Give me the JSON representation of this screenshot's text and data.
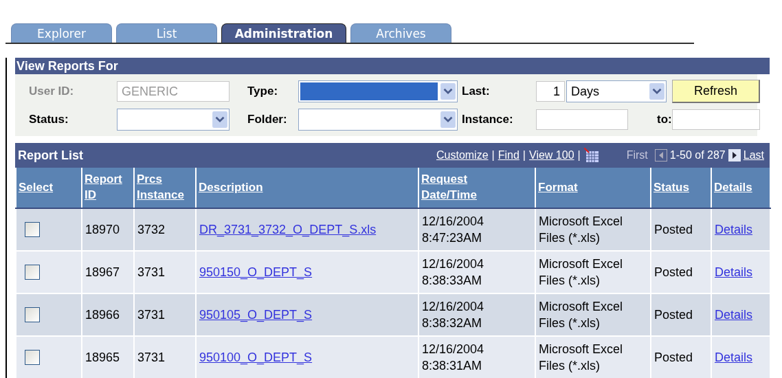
{
  "tabs": [
    {
      "label": "Explorer",
      "selected": false
    },
    {
      "label": "List",
      "selected": false
    },
    {
      "label": "Administration",
      "selected": true
    },
    {
      "label": "Archives",
      "selected": false
    }
  ],
  "view_reports": {
    "title": "View Reports For",
    "user_id": {
      "label": "User ID:",
      "value": "GENERIC",
      "disabled": true
    },
    "type": {
      "label": "Type:",
      "highlighted": true
    },
    "last": {
      "label": "Last:",
      "value": "1",
      "unit": "Days"
    },
    "refresh": "Refresh",
    "status": {
      "label": "Status:"
    },
    "folder": {
      "label": "Folder:",
      "highlighted": false
    },
    "instance": {
      "label": "Instance:"
    },
    "to": {
      "label": "to:"
    }
  },
  "report_list": {
    "title": "Report List",
    "links": [
      "Customize",
      "Find",
      "View 100"
    ],
    "separator": "|",
    "first": "First",
    "range": "1-50 of 287",
    "last": "Last",
    "columns": [
      "Select",
      "Report ID",
      "Prcs Instance",
      "Description",
      "Request Date/Time",
      "Format",
      "Status",
      "Details"
    ],
    "rows": [
      {
        "checked": false,
        "report_id": "18970",
        "prcs_instance": "3732",
        "description": "DR_3731_3732_O_DEPT_S.xls",
        "date": "12/16/2004",
        "time": "8:47:23AM",
        "format": "Microsoft Excel Files (*.xls)",
        "status": "Posted",
        "details": "Details"
      },
      {
        "checked": false,
        "report_id": "18967",
        "prcs_instance": "3731",
        "description": "950150_O_DEPT_S",
        "date": "12/16/2004",
        "time": "8:38:33AM",
        "format": "Microsoft Excel Files (*.xls)",
        "status": "Posted",
        "details": "Details"
      },
      {
        "checked": false,
        "report_id": "18966",
        "prcs_instance": "3731",
        "description": "950105_O_DEPT_S",
        "date": "12/16/2004",
        "time": "8:38:32AM",
        "format": "Microsoft Excel Files (*.xls)",
        "status": "Posted",
        "details": "Details"
      },
      {
        "checked": false,
        "report_id": "18965",
        "prcs_instance": "3731",
        "description": "950100_O_DEPT_S",
        "date": "12/16/2004",
        "time": "8:38:31AM",
        "format": "Microsoft Excel Files (*.xls)",
        "status": "Posted",
        "details": "Details"
      }
    ]
  }
}
